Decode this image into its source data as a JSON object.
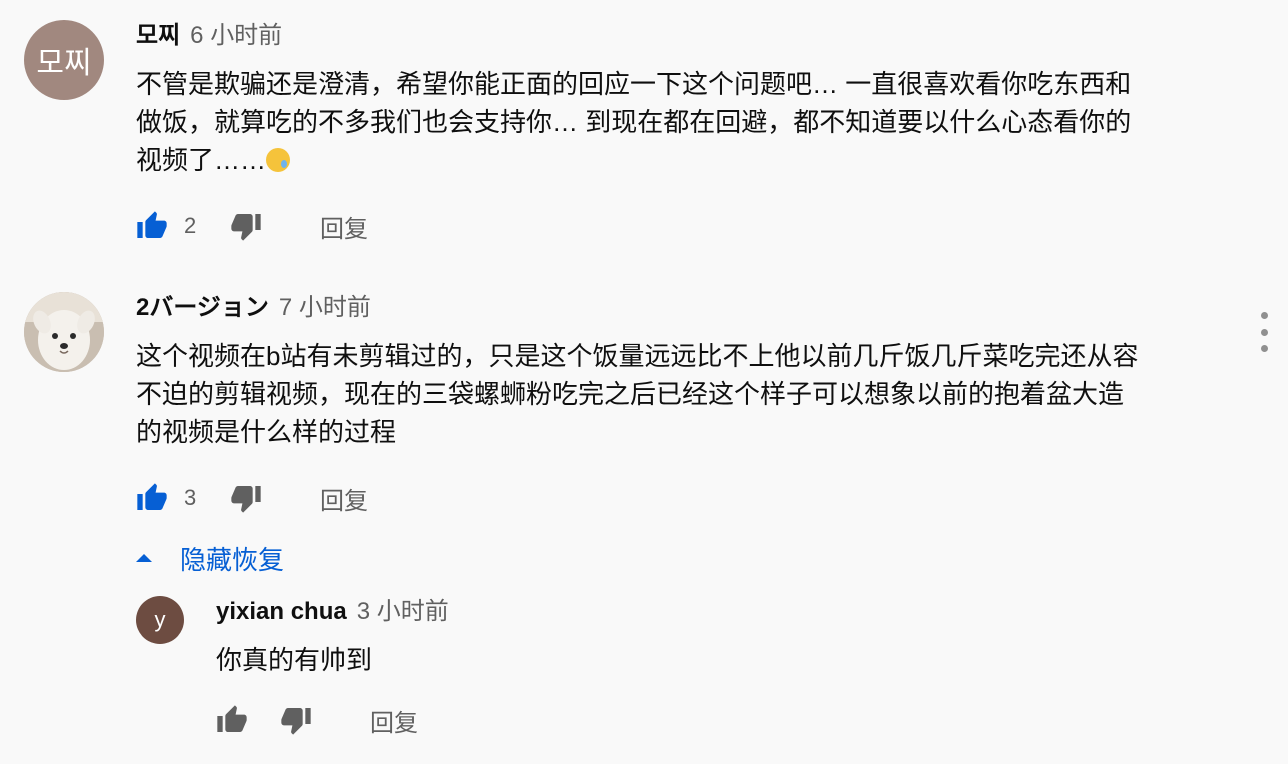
{
  "comments": [
    {
      "avatar_text": "모찌",
      "avatar_color": "#a1887f",
      "author": "모찌",
      "time": "6 小时前",
      "lines": [
        "不管是欺骗还是澄清，希望你能正面的回应一下这个问题吧… 一直很喜欢看你吃东西和",
        "做饭，就算吃的不多我们也会支持你… 到现在都在回避，都不知道要以什么心态看你的",
        "视频了……"
      ],
      "emoji": "crying-face-emoji",
      "likes": "2",
      "reply_label": "回复"
    },
    {
      "avatar_icon": "white-dog-photo",
      "author": "2バージョン",
      "time": "7 小时前",
      "lines": [
        "这个视频在b站有未剪辑过的，只是这个饭量远远比不上他以前几斤饭几斤菜吃完还从容",
        "不迫的剪辑视频，现在的三袋螺蛳粉吃完之后已经这个样子可以想象以前的抱着盆大造",
        "的视频是什么样的过程"
      ],
      "likes": "3",
      "reply_label": "回复",
      "hide_replies_label": "隐藏恢复"
    }
  ],
  "reply": {
    "avatar_text": "y",
    "avatar_color": "#6d4c41",
    "author": "yixian chua",
    "time": "3 小时前",
    "text": "你真的有帅到",
    "reply_label": "回复"
  },
  "colors": {
    "like_active": "#065fd4",
    "icon_gray": "#606060",
    "link_blue": "#065fd4"
  }
}
